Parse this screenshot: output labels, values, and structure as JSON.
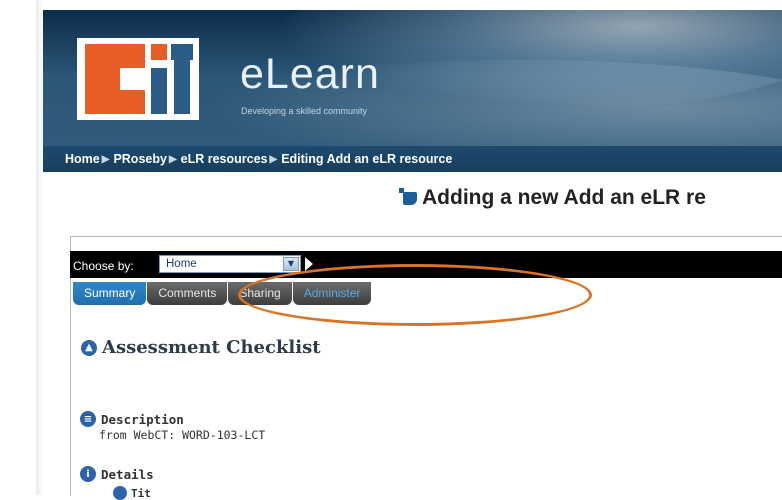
{
  "header": {
    "site_name": "eLearn",
    "tagline": "Developing a skilled community",
    "logo_text": "CIT"
  },
  "breadcrumb": {
    "items": [
      "Home",
      "PRoseby",
      "eLR resources",
      "Editing Add an eLR resource"
    ],
    "separator": "▶"
  },
  "page": {
    "heading": "Adding a new Add an eLR re"
  },
  "chooser": {
    "label": "Choose by:",
    "value": "Home"
  },
  "tabs": [
    {
      "label": "Summary",
      "active": true
    },
    {
      "label": "Comments",
      "active": false
    },
    {
      "label": "Sharing",
      "active": false
    },
    {
      "label": "Administer",
      "active": false
    }
  ],
  "content": {
    "title": "Assessment Checklist",
    "description_label": "Description",
    "description_value": "from WebCT: WORD-103-LCT",
    "details_label": "Details",
    "partial_label": "Tit"
  },
  "colors": {
    "banner": "#1e4a6e",
    "logo_orange": "#e85d26",
    "logo_blue": "#2b5c86",
    "tab_active": "#2f88c9",
    "highlight_ellipse": "#d97326"
  },
  "icons": {
    "title_icon": "round-up-icon",
    "description_icon": "list-icon",
    "details_icon": "info-icon"
  }
}
